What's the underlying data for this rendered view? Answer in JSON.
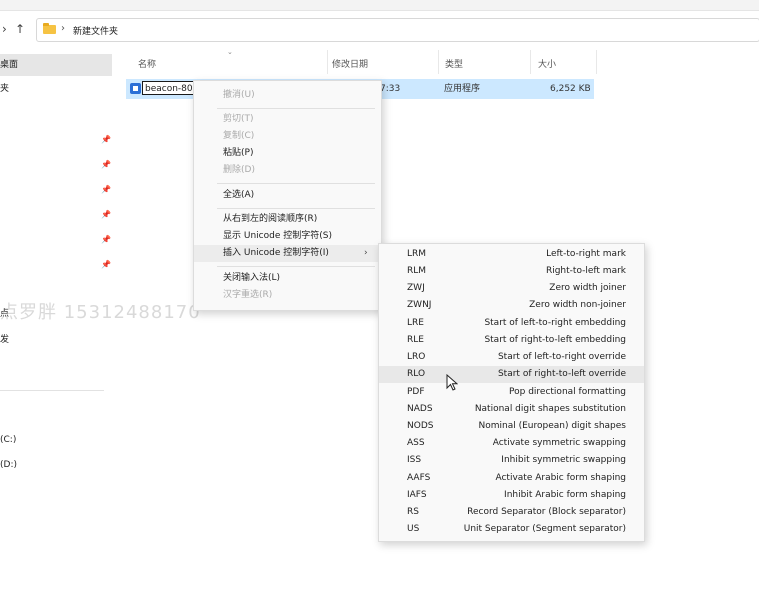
{
  "nav": {
    "forward_glyph": "›",
    "up_glyph": "↑"
  },
  "address": {
    "separator": "›",
    "path": "新建文件夹"
  },
  "sidebar": {
    "items": [
      {
        "label": "桌面",
        "selected": true
      },
      {
        "label": "夹"
      },
      {
        "label": ""
      },
      {
        "label": ""
      },
      {
        "label": ""
      },
      {
        "label": ""
      },
      {
        "label": ""
      },
      {
        "label": ""
      }
    ],
    "lower": [
      {
        "label": "点"
      },
      {
        "label": "发"
      }
    ],
    "drives": [
      {
        "label": ""
      },
      {
        "label": "(C:)"
      },
      {
        "label": "(D:)"
      }
    ],
    "pin_glyph": "📌"
  },
  "columns": {
    "name": "名称",
    "modified": "修改日期",
    "type": "类型",
    "size": "大小"
  },
  "file": {
    "rename_value": "beacon-80",
    "modified": "7:33",
    "type": "应用程序",
    "size": "6,252 KB"
  },
  "watermark": "点罗胖 15312488170",
  "context_menu": {
    "items": [
      {
        "label": "撤消(U)",
        "enabled": false
      },
      {
        "sep": true
      },
      {
        "label": "剪切(T)",
        "enabled": false
      },
      {
        "label": "复制(C)",
        "enabled": false
      },
      {
        "label": "粘贴(P)",
        "enabled": true
      },
      {
        "label": "删除(D)",
        "enabled": false
      },
      {
        "sep": true
      },
      {
        "label": "全选(A)",
        "enabled": true
      },
      {
        "sep": true
      },
      {
        "label": "从右到左的阅读顺序(R)",
        "enabled": true
      },
      {
        "label": "显示 Unicode 控制字符(S)",
        "enabled": true
      },
      {
        "label": "插入 Unicode 控制字符(I)",
        "enabled": true,
        "submenu": true,
        "highlighted": true
      },
      {
        "sep": true
      },
      {
        "label": "关闭输入法(L)",
        "enabled": true
      },
      {
        "label": "汉字重选(R)",
        "enabled": false
      }
    ],
    "submenu_arrow": "›"
  },
  "unicode_submenu": [
    {
      "code": "LRM",
      "name": "Left-to-right mark"
    },
    {
      "code": "RLM",
      "name": "Right-to-left mark"
    },
    {
      "code": "ZWJ",
      "name": "Zero width joiner"
    },
    {
      "code": "ZWNJ",
      "name": "Zero width non-joiner"
    },
    {
      "code": "LRE",
      "name": "Start of left-to-right embedding"
    },
    {
      "code": "RLE",
      "name": "Start of right-to-left embedding"
    },
    {
      "code": "LRO",
      "name": "Start of left-to-right override"
    },
    {
      "code": "RLO",
      "name": "Start of right-to-left override",
      "hover": true
    },
    {
      "code": "PDF",
      "name": "Pop directional formatting"
    },
    {
      "code": "NADS",
      "name": "National digit shapes substitution"
    },
    {
      "code": "NODS",
      "name": "Nominal (European) digit shapes"
    },
    {
      "code": "ASS",
      "name": "Activate symmetric swapping"
    },
    {
      "code": "ISS",
      "name": "Inhibit symmetric swapping"
    },
    {
      "code": "AAFS",
      "name": "Activate Arabic form shaping"
    },
    {
      "code": "IAFS",
      "name": "Inhibit Arabic form shaping"
    },
    {
      "code": "RS",
      "name": "Record Separator (Block separator)"
    },
    {
      "code": "US",
      "name": "Unit Separator (Segment separator)"
    }
  ]
}
